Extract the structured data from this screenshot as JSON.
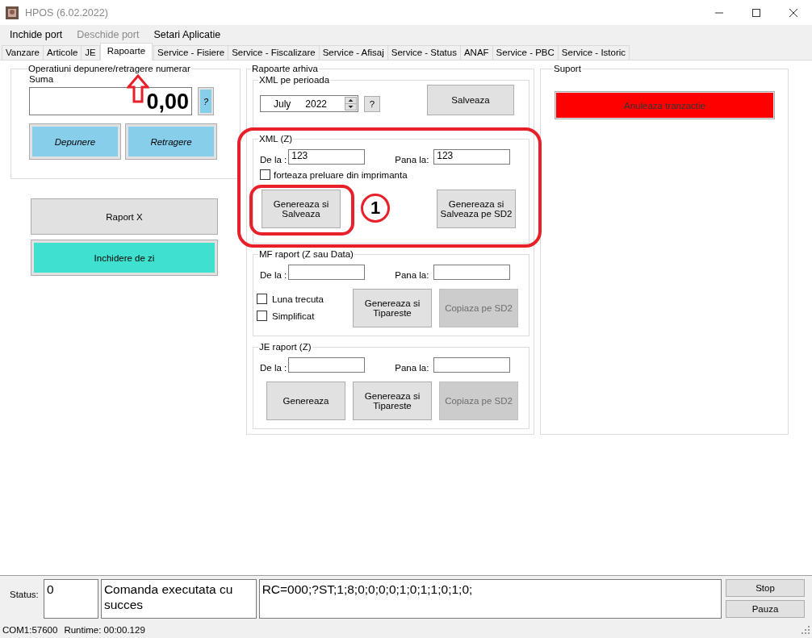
{
  "window": {
    "title": "HPOS (6.02.2022)"
  },
  "menu": [
    {
      "label": "Inchide port",
      "disabled": false
    },
    {
      "label": "Deschide port",
      "disabled": true
    },
    {
      "label": "Setari Aplicatie",
      "disabled": false
    }
  ],
  "tabs": [
    {
      "label": "Vanzare",
      "selected": false
    },
    {
      "label": "Articole",
      "selected": false
    },
    {
      "label": "JE",
      "selected": false
    },
    {
      "label": "Rapoarte",
      "selected": true
    },
    {
      "label": "Service - Fisiere",
      "selected": false
    },
    {
      "label": "Service - Fiscalizare",
      "selected": false
    },
    {
      "label": "Service - Afisaj",
      "selected": false
    },
    {
      "label": "Service - Status",
      "selected": false
    },
    {
      "label": "ANAF",
      "selected": false
    },
    {
      "label": "Service - PBC",
      "selected": false
    },
    {
      "label": "Service - Istoric",
      "selected": false
    }
  ],
  "cash_operations": {
    "title": "Operatiuni depunere/retragere numerar",
    "amount_label": "Suma",
    "amount": "0,00",
    "help_button": "?",
    "buttons": [
      "Depunere",
      "Retragere"
    ]
  },
  "day_buttons": [
    {
      "label": "Raport X",
      "kind": "plain"
    },
    {
      "label": "Inchidere de zi",
      "kind": "accent"
    }
  ],
  "archive_reports": {
    "title": "Rapoarte arhiva",
    "xml_period": {
      "title": "XML pe perioada",
      "month": "July",
      "year": "2022",
      "help_button": "?",
      "save_button": "Salveaza"
    },
    "sections": [
      {
        "title": "XML (Z)",
        "kind": "stacked",
        "from_label": "De la :",
        "from_value": "123",
        "to_label": "Pana la:",
        "to_value": "123",
        "checkboxes": [
          {
            "label": "forteaza preluare din imprimanta",
            "checked": false
          }
        ],
        "buttons": [
          {
            "label": "Genereaza si Salveaza",
            "disabled": false
          },
          {
            "label": "Genereaza si Salveaza pe SD2",
            "disabled": false
          }
        ]
      },
      {
        "title": "MF raport (Z sau Data)",
        "kind": "inline",
        "from_label": "De la :",
        "to_label": "Pana la:",
        "checkboxes": [
          {
            "label": "Luna trecuta",
            "checked": false
          },
          {
            "label": "Simplificat",
            "checked": false
          }
        ],
        "buttons": [
          {
            "label": "Genereaza si Tipareste",
            "disabled": false
          },
          {
            "label": "Copiaza pe SD2",
            "disabled": true
          }
        ]
      },
      {
        "title": "JE raport (Z)",
        "kind": "inline",
        "from_label": "De la :",
        "to_label": "Pana la:",
        "buttons": [
          {
            "label": "Genereaza",
            "disabled": false
          },
          {
            "label": "Genereaza si Tipareste",
            "disabled": false
          },
          {
            "label": "Copiaza pe SD2",
            "disabled": true
          }
        ]
      }
    ]
  },
  "support": {
    "title": "Suport",
    "button": "Anuleaza tranzactie"
  },
  "status_panel": {
    "label": "Status:",
    "code": "0",
    "message": "Comanda executata cu succes",
    "response": "RC=000;?ST;1;8;0;0;0;0;1;0;1;1;0;1;0;",
    "buttons": [
      "Stop",
      "Pauza"
    ]
  },
  "status_bar": {
    "port": "COM1:57600",
    "runtime": "Runtime: 00:00.129"
  },
  "annotation": {
    "step": "1"
  }
}
